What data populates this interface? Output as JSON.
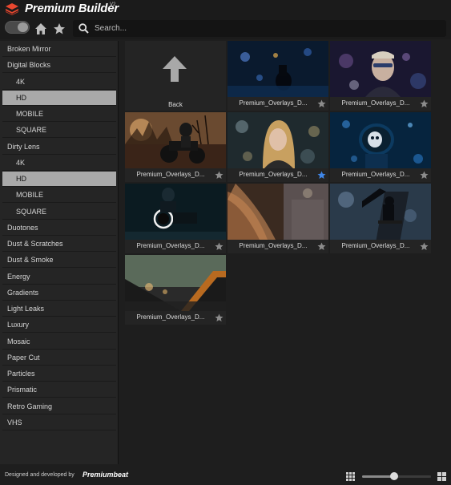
{
  "app": {
    "title": "Premium Builder",
    "version": "V2"
  },
  "toolbar": {
    "search_placeholder": "Search..."
  },
  "sidebar": {
    "items": [
      {
        "label": "Broken Mirror",
        "level": 0,
        "selected": false
      },
      {
        "label": "Digital Blocks",
        "level": 0,
        "selected": false
      },
      {
        "label": "4K",
        "level": 1,
        "selected": false
      },
      {
        "label": "HD",
        "level": 1,
        "selected": true
      },
      {
        "label": "MOBILE",
        "level": 1,
        "selected": false
      },
      {
        "label": "SQUARE",
        "level": 1,
        "selected": false
      },
      {
        "label": "Dirty Lens",
        "level": 0,
        "selected": false
      },
      {
        "label": "4K",
        "level": 1,
        "selected": false
      },
      {
        "label": "HD",
        "level": 1,
        "selected": true
      },
      {
        "label": "MOBILE",
        "level": 1,
        "selected": false
      },
      {
        "label": "SQUARE",
        "level": 1,
        "selected": false
      },
      {
        "label": "Duotones",
        "level": 0,
        "selected": false
      },
      {
        "label": "Dust & Scratches",
        "level": 0,
        "selected": false
      },
      {
        "label": "Dust & Smoke",
        "level": 0,
        "selected": false
      },
      {
        "label": "Energy",
        "level": 0,
        "selected": false
      },
      {
        "label": "Gradients",
        "level": 0,
        "selected": false
      },
      {
        "label": "Light Leaks",
        "level": 0,
        "selected": false
      },
      {
        "label": "Luxury",
        "level": 0,
        "selected": false
      },
      {
        "label": "Mosaic",
        "level": 0,
        "selected": false
      },
      {
        "label": "Paper Cut",
        "level": 0,
        "selected": false
      },
      {
        "label": "Particles",
        "level": 0,
        "selected": false
      },
      {
        "label": "Prismatic",
        "level": 0,
        "selected": false
      },
      {
        "label": "Retro Gaming",
        "level": 0,
        "selected": false
      },
      {
        "label": "VHS",
        "level": 0,
        "selected": false
      }
    ]
  },
  "grid": {
    "back_label": "Back",
    "tiles": [
      {
        "label": "Premium_Overlays_D...",
        "favorite": false,
        "scene": "night-street-rider"
      },
      {
        "label": "Premium_Overlays_D...",
        "favorite": false,
        "scene": "man-glasses-bokeh"
      },
      {
        "label": "Premium_Overlays_D...",
        "favorite": false,
        "scene": "motorcycle-sunset"
      },
      {
        "label": "Premium_Overlays_D...",
        "favorite": true,
        "scene": "woman-bokeh"
      },
      {
        "label": "Premium_Overlays_D...",
        "favorite": false,
        "scene": "astronaut-helmet"
      },
      {
        "label": "Premium_Overlays_D...",
        "favorite": false,
        "scene": "motorcycle-neon"
      },
      {
        "label": "Premium_Overlays_D...",
        "favorite": false,
        "scene": "woman-hair-light"
      },
      {
        "label": "Premium_Overlays_D...",
        "favorite": false,
        "scene": "skater-silhouette"
      },
      {
        "label": "Premium_Overlays_D...",
        "favorite": false,
        "scene": "car-window-city"
      }
    ]
  },
  "footer": {
    "credit": "Designed and developed by",
    "brand": "Premiumbeat",
    "thumb_size": 0.47
  },
  "colors": {
    "favorite_active": "#3f86e8",
    "favorite_inactive": "#8c8c8c",
    "selected_bg": "#a9a9a9",
    "logo_red": "#e8472f"
  }
}
